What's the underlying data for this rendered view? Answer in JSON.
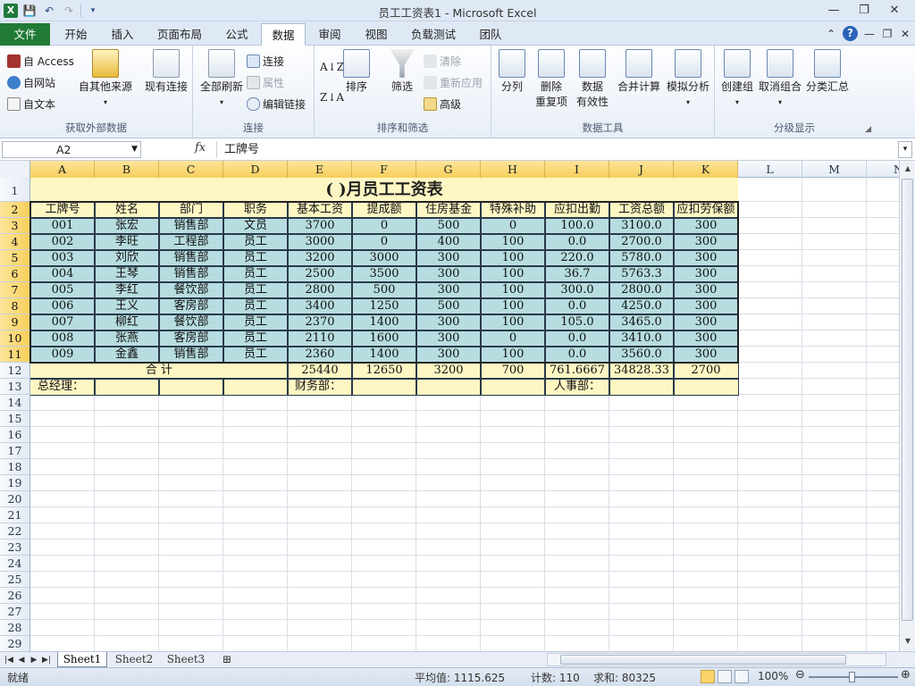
{
  "window": {
    "title": "员工工资表1 - Microsoft Excel",
    "app_icon": "X"
  },
  "ribbon_tabs": [
    "文件",
    "开始",
    "插入",
    "页面布局",
    "公式",
    "数据",
    "审阅",
    "视图",
    "负载测试",
    "团队"
  ],
  "active_tab": "数据",
  "ribbon": {
    "get_external": {
      "label": "获取外部数据",
      "access": "自 Access",
      "web": "自网站",
      "text": "自文本",
      "other": "自其他来源",
      "existing": "现有连接"
    },
    "connections": {
      "label": "连接",
      "refresh_all": "全部刷新",
      "connections": "连接",
      "properties": "属性",
      "edit_links": "编辑链接"
    },
    "sort_filter": {
      "label": "排序和筛选",
      "sort": "排序",
      "filter": "筛选",
      "clear": "清除",
      "reapply": "重新应用",
      "advanced": "高级"
    },
    "data_tools": {
      "label": "数据工具",
      "text_to_columns": "分列",
      "remove_dup_1": "删除",
      "remove_dup_2": "重复项",
      "validation_1": "数据",
      "validation_2": "有效性",
      "consolidate": "合并计算",
      "what_if": "模拟分析"
    },
    "outline": {
      "label": "分级显示",
      "group": "创建组",
      "ungroup": "取消组合",
      "subtotal": "分类汇总"
    }
  },
  "formula_bar": {
    "name_box": "A2",
    "fx": "fx",
    "content": "工牌号"
  },
  "columns": [
    "A",
    "B",
    "C",
    "D",
    "E",
    "F",
    "G",
    "H",
    "I",
    "J",
    "K",
    "L",
    "M",
    "N"
  ],
  "rows": [
    "1",
    "2",
    "3",
    "4",
    "5",
    "6",
    "7",
    "8",
    "9",
    "10",
    "11",
    "12",
    "13",
    "14",
    "15",
    "16",
    "17",
    "18",
    "19",
    "20",
    "21",
    "22",
    "23",
    "24",
    "25",
    "26",
    "27",
    "28",
    "29"
  ],
  "sheet": {
    "title": "(  )月员工工资表",
    "headers": [
      "工牌号",
      "姓名",
      "部门",
      "职务",
      "基本工资",
      "提成额",
      "住房基金",
      "特殊补助",
      "应扣出勤",
      "工资总额",
      "应扣劳保额"
    ],
    "data": [
      [
        "001",
        "张宏",
        "销售部",
        "文员",
        "3700",
        "0",
        "500",
        "0",
        "100.0",
        "3100.0",
        "300"
      ],
      [
        "002",
        "李旺",
        "工程部",
        "员工",
        "3000",
        "0",
        "400",
        "100",
        "0.0",
        "2700.0",
        "300"
      ],
      [
        "003",
        "刘欣",
        "销售部",
        "员工",
        "3200",
        "3000",
        "300",
        "100",
        "220.0",
        "5780.0",
        "300"
      ],
      [
        "004",
        "王琴",
        "销售部",
        "员工",
        "2500",
        "3500",
        "300",
        "100",
        "36.7",
        "5763.3",
        "300"
      ],
      [
        "005",
        "李红",
        "餐饮部",
        "员工",
        "2800",
        "500",
        "300",
        "100",
        "300.0",
        "2800.0",
        "300"
      ],
      [
        "006",
        "王义",
        "客房部",
        "员工",
        "3400",
        "1250",
        "500",
        "100",
        "0.0",
        "4250.0",
        "300"
      ],
      [
        "007",
        "柳红",
        "餐饮部",
        "员工",
        "2370",
        "1400",
        "300",
        "100",
        "105.0",
        "3465.0",
        "300"
      ],
      [
        "008",
        "张燕",
        "客房部",
        "员工",
        "2110",
        "1600",
        "300",
        "0",
        "0.0",
        "3410.0",
        "300"
      ],
      [
        "009",
        "金鑫",
        "销售部",
        "员工",
        "2360",
        "1400",
        "300",
        "100",
        "0.0",
        "3560.0",
        "300"
      ]
    ],
    "total_label": "合  计",
    "totals": [
      "25440",
      "12650",
      "3200",
      "700",
      "761.6667",
      "34828.33",
      "2700"
    ],
    "signatures": {
      "manager": "总经理：",
      "finance": "财务部：",
      "hr": "人事部："
    }
  },
  "sheet_tabs": [
    "Sheet1",
    "Sheet2",
    "Sheet3"
  ],
  "active_sheet": "Sheet1",
  "status": {
    "mode": "就绪",
    "average": "平均值: 1115.625",
    "count": "计数: 110",
    "sum": "求和: 80325",
    "zoom": "100%"
  },
  "colors": {
    "header_fill": "#fef7c3",
    "data_fill": "#b7dde0",
    "file_tab": "#217a35"
  }
}
